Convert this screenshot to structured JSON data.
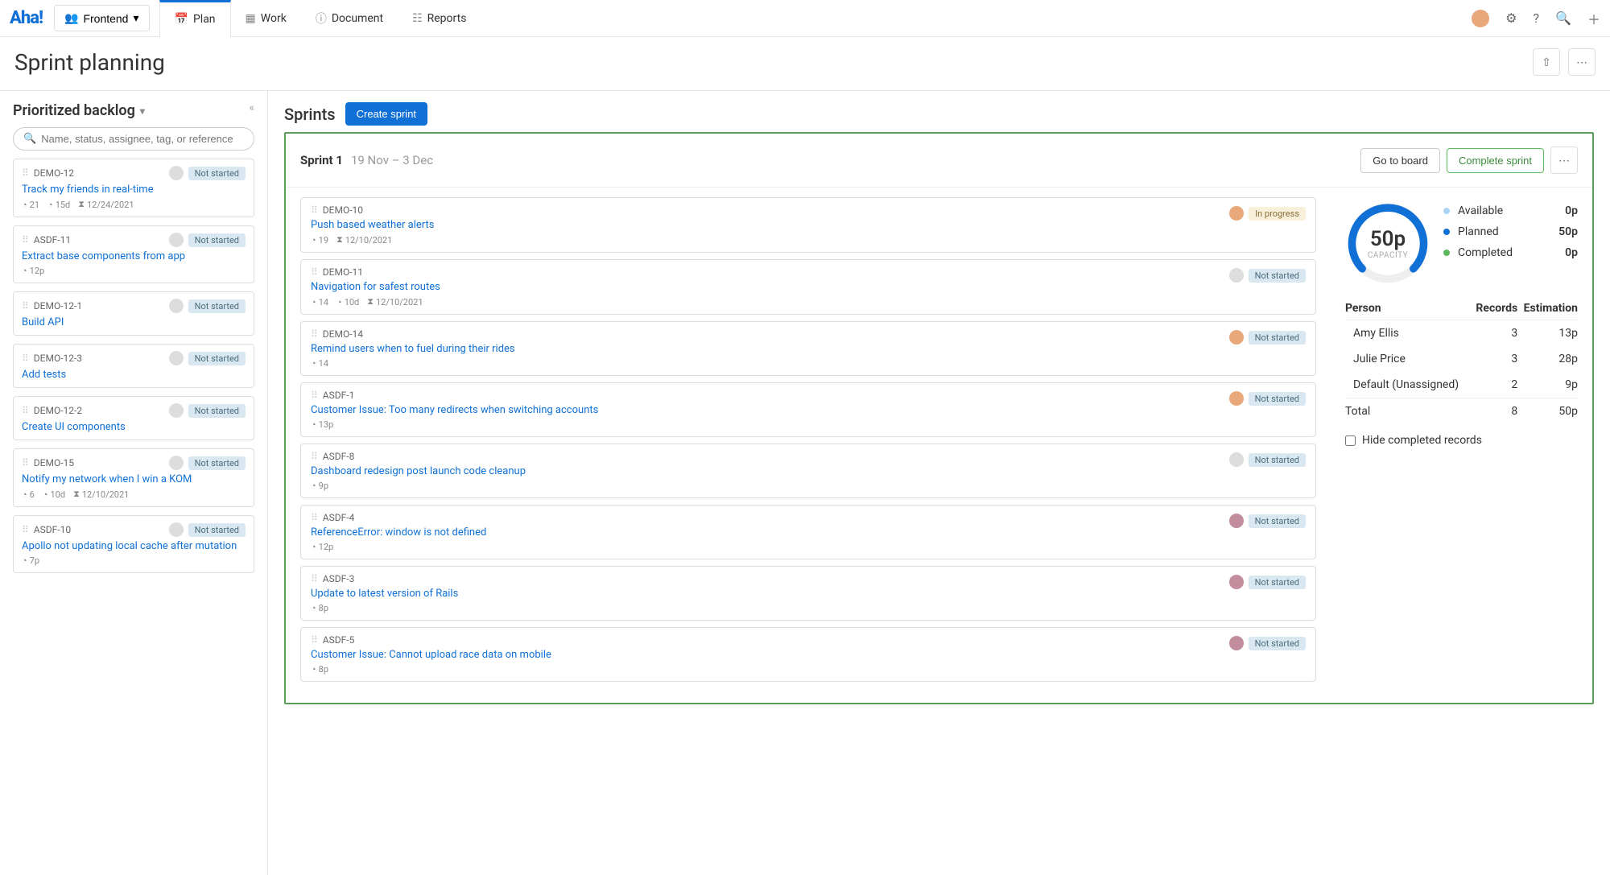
{
  "logo": "Aha!",
  "workspace": "Frontend",
  "nav": {
    "plan": "Plan",
    "work": "Work",
    "document": "Document",
    "reports": "Reports"
  },
  "page_title": "Sprint planning",
  "sidebar": {
    "title": "Prioritized backlog",
    "search_placeholder": "Name, status, assignee, tag, or reference",
    "items": [
      {
        "ref": "DEMO-12",
        "title": "Track my friends in real-time",
        "status": "Not started",
        "m1": "21",
        "m2": "15d",
        "m3": "12/24/2021"
      },
      {
        "ref": "ASDF-11",
        "title": "Extract base components from app",
        "status": "Not started",
        "m1": "12p"
      },
      {
        "ref": "DEMO-12-1",
        "title": "Build API",
        "status": "Not started"
      },
      {
        "ref": "DEMO-12-3",
        "title": "Add tests",
        "status": "Not started"
      },
      {
        "ref": "DEMO-12-2",
        "title": "Create UI components",
        "status": "Not started"
      },
      {
        "ref": "DEMO-15",
        "title": "Notify my network when I win a KOM",
        "status": "Not started",
        "m1": "6",
        "m2": "10d",
        "m3": "12/10/2021"
      },
      {
        "ref": "ASDF-10",
        "title": "Apollo not updating local cache after mutation",
        "status": "Not started",
        "m1": "7p"
      }
    ]
  },
  "sprints": {
    "heading": "Sprints",
    "create_label": "Create sprint",
    "sprint_name": "Sprint 1",
    "sprint_dates": "19 Nov – 3 Dec",
    "go_board": "Go to board",
    "complete": "Complete sprint",
    "cards": [
      {
        "ref": "DEMO-10",
        "title": "Push based weather alerts",
        "status": "In progress",
        "status_class": "progress",
        "avatar": "amy",
        "m1": "19",
        "m3": "12/10/2021"
      },
      {
        "ref": "DEMO-11",
        "title": "Navigation for safest routes",
        "status": "Not started",
        "avatar": "",
        "m1": "14",
        "m2": "10d",
        "m3": "12/10/2021"
      },
      {
        "ref": "DEMO-14",
        "title": "Remind users when to fuel during their rides",
        "status": "Not started",
        "avatar": "amy",
        "m1": "14"
      },
      {
        "ref": "ASDF-1",
        "title": "Customer Issue: Too many redirects when switching accounts",
        "status": "Not started",
        "avatar": "amy",
        "m1": "13p"
      },
      {
        "ref": "ASDF-8",
        "title": "Dashboard redesign post launch code cleanup",
        "status": "Not started",
        "avatar": "",
        "m1": "9p"
      },
      {
        "ref": "ASDF-4",
        "title": "ReferenceError: window is not defined",
        "status": "Not started",
        "avatar": "julie",
        "m1": "12p"
      },
      {
        "ref": "ASDF-3",
        "title": "Update to latest version of Rails",
        "status": "Not started",
        "avatar": "julie",
        "m1": "8p"
      },
      {
        "ref": "ASDF-5",
        "title": "Customer Issue: Cannot upload race data on mobile",
        "status": "Not started",
        "avatar": "julie",
        "m1": "8p"
      }
    ],
    "capacity": {
      "value": "50p",
      "label": "CAPACITY",
      "legend": {
        "avail_label": "Available",
        "avail_val": "0p",
        "plan_label": "Planned",
        "plan_val": "50p",
        "comp_label": "Completed",
        "comp_val": "0p"
      }
    },
    "persons": {
      "headers": {
        "person": "Person",
        "records": "Records",
        "estimation": "Estimation"
      },
      "rows": [
        {
          "name": "Amy Ellis",
          "records": "3",
          "est": "13p"
        },
        {
          "name": "Julie Price",
          "records": "3",
          "est": "28p"
        },
        {
          "name": "Default (Unassigned)",
          "records": "2",
          "est": "9p"
        }
      ],
      "total": {
        "name": "Total",
        "records": "8",
        "est": "50p"
      }
    },
    "hide_completed": "Hide completed records"
  }
}
